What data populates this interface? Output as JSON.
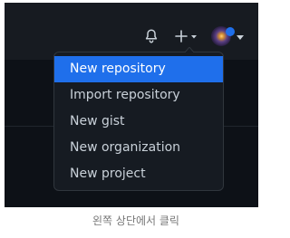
{
  "header": {
    "notification_icon": "bell-icon",
    "create_icon": "plus-icon",
    "avatar_icon": "avatar"
  },
  "menu": {
    "items": [
      {
        "label": "New repository",
        "active": true
      },
      {
        "label": "Import repository",
        "active": false
      },
      {
        "label": "New gist",
        "active": false
      },
      {
        "label": "New organization",
        "active": false
      },
      {
        "label": "New project",
        "active": false
      }
    ]
  },
  "caption": "왼쪽 상단에서 클릭",
  "colors": {
    "page_bg": "#ffffff",
    "header_bg": "#171b21",
    "app_bg": "#0d1117",
    "menu_bg": "#161b22",
    "menu_border": "#30363d",
    "menu_text": "#c9d1d9",
    "active_bg": "#1f6feb",
    "active_text": "#ffffff",
    "caption_text": "#777777"
  }
}
